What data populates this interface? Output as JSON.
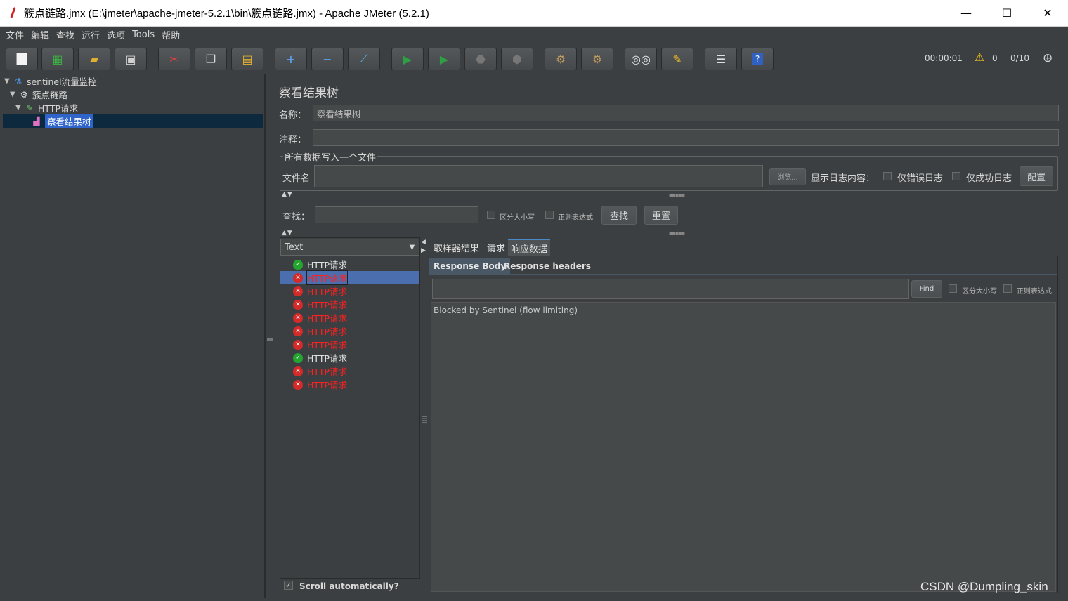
{
  "window": {
    "title": "簇点链路.jmx (E:\\jmeter\\apache-jmeter-5.2.1\\bin\\簇点链路.jmx) - Apache JMeter (5.2.1)",
    "minimize": "—",
    "maximize": "☐",
    "close": "✕"
  },
  "menu": [
    "文件",
    "编辑",
    "查找",
    "运行",
    "选项",
    "Tools",
    "帮助"
  ],
  "toolbar": {
    "timer": "00:00:01",
    "warnings": "0",
    "threads": "0/10",
    "buttons": [
      "new-icon",
      "templates-icon",
      "open-icon",
      "save-icon",
      "cut-icon",
      "copy-icon",
      "paste-icon",
      "add-icon",
      "remove-icon",
      "toggle-icon",
      "start-icon",
      "start-no-pause-icon",
      "stop-icon",
      "shutdown-icon",
      "clear-icon",
      "clear-all-icon",
      "search-icon",
      "reset-search-icon",
      "function-helper-icon",
      "help-icon"
    ]
  },
  "tree": {
    "items": [
      {
        "label": "sentinel流量监控",
        "icon": "test-plan-icon"
      },
      {
        "label": "簇点链路",
        "icon": "thread-group-icon"
      },
      {
        "label": "HTTP请求",
        "icon": "sampler-icon"
      },
      {
        "label": "察看结果树",
        "icon": "listener-icon"
      }
    ]
  },
  "panel": {
    "title": "察看结果树",
    "name_label": "名称：",
    "name_value": "察看结果树",
    "comment_label": "注释：",
    "comment_value": "",
    "file_group_legend": "所有数据写入一个文件",
    "filename_label": "文件名",
    "browse_button": "浏览...",
    "log_content_label": "显示日志内容：",
    "errors_only": "仅错误日志",
    "success_only": "仅成功日志",
    "configure_button": "配置",
    "search_label": "查找：",
    "case_sensitive": "区分大小写",
    "regex": "正则表达式",
    "search_button": "查找",
    "reset_button": "重置"
  },
  "results": {
    "renderer": "Text",
    "scroll_auto": "Scroll automatically?",
    "items": [
      {
        "label": "HTTP请求",
        "status": "ok"
      },
      {
        "label": "HTTP请求",
        "status": "err"
      },
      {
        "label": "HTTP请求",
        "status": "err"
      },
      {
        "label": "HTTP请求",
        "status": "err"
      },
      {
        "label": "HTTP请求",
        "status": "err"
      },
      {
        "label": "HTTP请求",
        "status": "err"
      },
      {
        "label": "HTTP请求",
        "status": "err"
      },
      {
        "label": "HTTP请求",
        "status": "ok"
      },
      {
        "label": "HTTP请求",
        "status": "err"
      },
      {
        "label": "HTTP请求",
        "status": "err"
      }
    ]
  },
  "detail": {
    "tabs": [
      "取样器结果",
      "请求",
      "响应数据"
    ],
    "subtabs": [
      "Response Body",
      "Response headers"
    ],
    "find_button": "Find",
    "case_sensitive": "区分大小写",
    "regex": "正则表达式",
    "body_text": "Blocked by Sentinel (flow limiting)"
  },
  "watermark": "CSDN @Dumpling_skin"
}
